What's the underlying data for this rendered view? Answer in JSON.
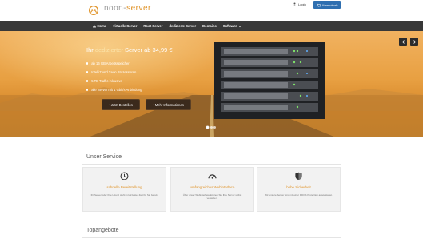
{
  "brand": {
    "name_prefix": "noon-",
    "name_suffix": "server",
    "accent_color": "#e0942a"
  },
  "topbar": {
    "login_label": "Login",
    "cart_label": "Warenkorb"
  },
  "nav": {
    "items": [
      {
        "label": "Home",
        "icon": "home-icon"
      },
      {
        "label": "virtuelle Server"
      },
      {
        "label": "Root-Server"
      },
      {
        "label": "dedizierte Server"
      },
      {
        "label": "Domains"
      },
      {
        "label": "Software",
        "icon": "chevron-down-icon"
      }
    ]
  },
  "hero": {
    "title_pre": "Ihr ",
    "title_highlight": "dedizierter",
    "title_post": " Server ab 34,99 €",
    "features": [
      "ab 16 GB Arbeitsspeicher",
      "Intel i7 und Xeon Prozessoren",
      "5 TB Traffic inklusive",
      "alle Server mit 1 Gbit/s Anbindung"
    ],
    "order_button": "Jetzt Bestellen",
    "info_button": "Mehr Informationen",
    "slide_count": 3,
    "active_slide": 1
  },
  "service": {
    "title": "Unser Service",
    "cards": [
      {
        "icon": "clock-icon",
        "title": "schnelle Bereitstellung",
        "text": "Ihr Server oder Ihre Lizenz steht in kürzester Zeit für Sie bereit."
      },
      {
        "icon": "dashboard-icon",
        "title": "umfangreiches Webinterface",
        "text": "Über unser Webinterface können Sie Ihre Server selbst verwalten."
      },
      {
        "icon": "shield-icon",
        "title": "hohe Sicherheit",
        "text": "Wir unsere Server sind mit einer DDOS Protection ausgestattet."
      }
    ]
  },
  "top_offers": {
    "title": "Topangebote"
  }
}
